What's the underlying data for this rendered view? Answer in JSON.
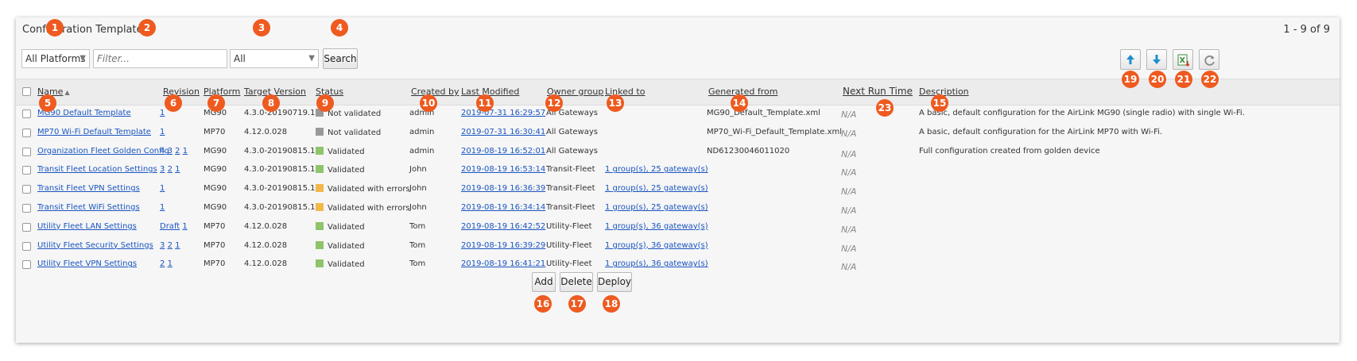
{
  "header": {
    "title": "Configuration Templates",
    "pager": "1 - 9 of 9"
  },
  "toolbar": {
    "platform_select": "All Platforms",
    "filter_placeholder": "Filter...",
    "status_select": "All",
    "search_label": "Search"
  },
  "icons": {
    "move_up": "arrow-up-icon",
    "move_down": "arrow-down-icon",
    "export": "excel-export-icon",
    "refresh": "refresh-icon"
  },
  "columns": {
    "name": "Name",
    "revision": "Revision",
    "platform": "Platform",
    "target_version": "Target Version",
    "status": "Status",
    "created_by": "Created by",
    "last_modified": "Last Modified",
    "owner_group": "Owner group",
    "linked_to": "Linked to",
    "generated_from": "Generated from",
    "next_run_time": "Next Run Time",
    "description": "Description"
  },
  "rows": [
    {
      "name": "MG90 Default Template",
      "revision": "1",
      "platform": "MG90",
      "target": "4.3.0-20190719.1",
      "status": "Not validated",
      "status_color": "#999999",
      "created_by": "admin",
      "modified": "2019-07-31 16:29:57",
      "owner": "All Gateways",
      "linked": "",
      "generated": "MG90_Default_Template.xml",
      "next_run": "N/A",
      "description": "A basic, default configuration for the AirLink MG90 (single radio) with single Wi-Fi."
    },
    {
      "name": "MP70 Wi-Fi Default Template",
      "revision": "1",
      "platform": "MP70",
      "target": "4.12.0.028",
      "status": "Not validated",
      "status_color": "#999999",
      "created_by": "admin",
      "modified": "2019-07-31 16:30:41",
      "owner": "All Gateways",
      "linked": "",
      "generated": "MP70_Wi-Fi_Default_Template.xml",
      "next_run": "N/A",
      "description": "A basic, default configuration for the AirLink MP70 with Wi-Fi."
    },
    {
      "name": "Organization Fleet Golden Config",
      "revision": "4 3 2 1",
      "platform": "MG90",
      "target": "4.3.0-20190815.1",
      "status": "Validated",
      "status_color": "#8fc46a",
      "created_by": "admin",
      "modified": "2019-08-19 16:52:01",
      "owner": "All Gateways",
      "linked": "",
      "generated": "ND61230046011020",
      "next_run": "N/A",
      "description": "Full configuration created from golden device"
    },
    {
      "name": "Transit Fleet Location Settings",
      "revision": "3 2 1",
      "platform": "MG90",
      "target": "4.3.0-20190815.1",
      "status": "Validated",
      "status_color": "#8fc46a",
      "created_by": "John",
      "modified": "2019-08-19 16:53:14",
      "owner": "Transit-Fleet",
      "linked": "1 group(s), 25 gateway(s)",
      "generated": "",
      "next_run": "N/A",
      "description": ""
    },
    {
      "name": "Transit Fleet VPN Settings",
      "revision": "1",
      "platform": "MG90",
      "target": "4.3.0-20190815.1",
      "status": "Validated with errors",
      "status_color": "#f2b84b",
      "created_by": "John",
      "modified": "2019-08-19 16:36:39",
      "owner": "Transit-Fleet",
      "linked": "1 group(s), 25 gateway(s)",
      "generated": "",
      "next_run": "N/A",
      "description": ""
    },
    {
      "name": "Transit Fleet WiFi Settings",
      "revision": "1",
      "platform": "MG90",
      "target": "4.3.0-20190815.1",
      "status": "Validated with errors",
      "status_color": "#f2b84b",
      "created_by": "John",
      "modified": "2019-08-19 16:34:14",
      "owner": "Transit-Fleet",
      "linked": "1 group(s), 25 gateway(s)",
      "generated": "",
      "next_run": "N/A",
      "description": ""
    },
    {
      "name": "Utility Fleet LAN Settings",
      "revision": "Draft 1",
      "platform": "MP70",
      "target": "4.12.0.028",
      "status": "Validated",
      "status_color": "#8fc46a",
      "created_by": "Tom",
      "modified": "2019-08-19 16:42:52",
      "owner": "Utility-Fleet",
      "linked": "1 group(s), 36 gateway(s)",
      "generated": "",
      "next_run": "N/A",
      "description": ""
    },
    {
      "name": "Utility Fleet Security Settings",
      "revision": "3 2 1",
      "platform": "MP70",
      "target": "4.12.0.028",
      "status": "Validated",
      "status_color": "#8fc46a",
      "created_by": "Tom",
      "modified": "2019-08-19 16:39:29",
      "owner": "Utility-Fleet",
      "linked": "1 group(s), 36 gateway(s)",
      "generated": "",
      "next_run": "N/A",
      "description": ""
    },
    {
      "name": "Utility Fleet VPN Settings",
      "revision": "2 1",
      "platform": "MP70",
      "target": "4.12.0.028",
      "status": "Validated",
      "status_color": "#8fc46a",
      "created_by": "Tom",
      "modified": "2019-08-19 16:41:21",
      "owner": "Utility-Fleet",
      "linked": "1 group(s), 36 gateway(s)",
      "generated": "",
      "next_run": "N/A",
      "description": ""
    }
  ],
  "actions": {
    "add": "Add",
    "delete": "Delete",
    "deploy": "Deploy"
  },
  "callouts": [
    "1",
    "2",
    "3",
    "4",
    "5",
    "6",
    "7",
    "8",
    "9",
    "10",
    "11",
    "12",
    "13",
    "14",
    "15",
    "16",
    "17",
    "18",
    "19",
    "20",
    "21",
    "22",
    "23"
  ],
  "callout_color": "#ee5a1f"
}
